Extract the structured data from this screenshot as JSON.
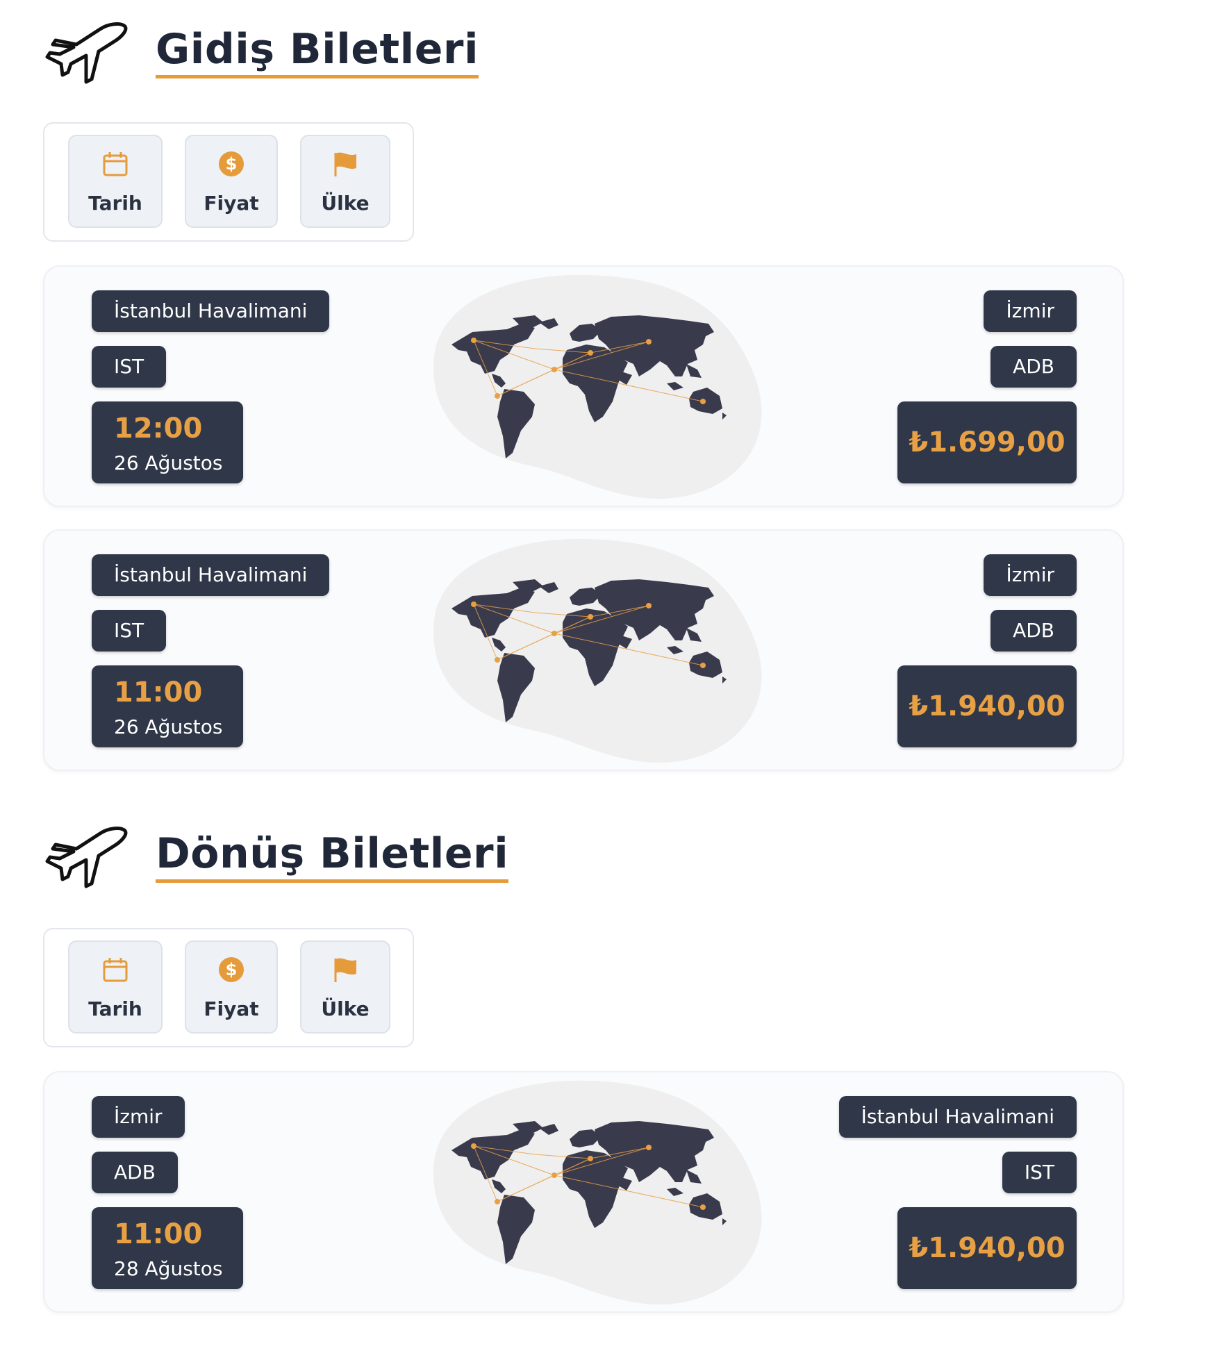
{
  "colors": {
    "accent": "#e69b3a",
    "pill_bg": "#2f3748",
    "map_land": "#3a3a4d",
    "map_blob": "#efefef"
  },
  "sections": [
    {
      "title": "Gidiş Biletleri",
      "icon": "airplane-icon",
      "filters": [
        {
          "label": "Tarih",
          "icon": "calendar-icon"
        },
        {
          "label": "Fiyat",
          "icon": "dollar-icon"
        },
        {
          "label": "Ülke",
          "icon": "flag-icon"
        }
      ],
      "tickets": [
        {
          "from_name": "İstanbul Havalimani",
          "from_code": "IST",
          "time": "12:00",
          "date": "26 Ağustos",
          "to_name": "İzmir",
          "to_code": "ADB",
          "price": "₺1.699,00"
        },
        {
          "from_name": "İstanbul Havalimani",
          "from_code": "IST",
          "time": "11:00",
          "date": "26 Ağustos",
          "to_name": "İzmir",
          "to_code": "ADB",
          "price": "₺1.940,00"
        }
      ]
    },
    {
      "title": "Dönüş Biletleri",
      "icon": "airplane-icon",
      "filters": [
        {
          "label": "Tarih",
          "icon": "calendar-icon"
        },
        {
          "label": "Fiyat",
          "icon": "dollar-icon"
        },
        {
          "label": "Ülke",
          "icon": "flag-icon"
        }
      ],
      "tickets": [
        {
          "from_name": "İzmir",
          "from_code": "ADB",
          "time": "11:00",
          "date": "28 Ağustos",
          "to_name": "İstanbul Havalimani",
          "to_code": "IST",
          "price": "₺1.940,00"
        }
      ]
    }
  ]
}
